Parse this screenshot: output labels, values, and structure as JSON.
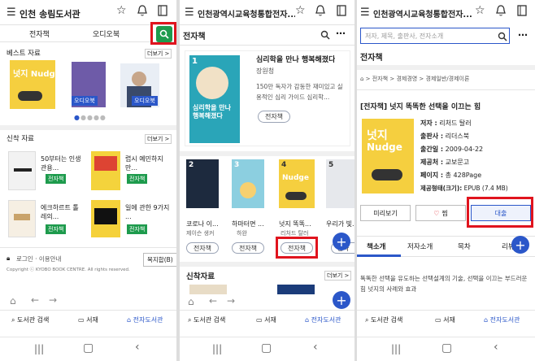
{
  "panel1": {
    "title": "인천 송림도서관",
    "tab_ebook": "전자책",
    "tab_audiobook": "오디오북",
    "best_heading": "베스트 자료",
    "more": "더보기 >",
    "best_books": [
      {
        "title": "넛지 Nudge",
        "badge": ""
      },
      {
        "title": "",
        "badge": "오디오북"
      },
      {
        "title": "",
        "badge": "오디오북"
      }
    ],
    "new_heading": "신착 자료",
    "new_books": [
      {
        "title": "50부터는 인생 관용...",
        "badge": "전자책"
      },
      {
        "title": "렵시 예민하지 만...",
        "badge": "전자책"
      },
      {
        "title": "에크하르트 톨 레의...",
        "badge": "전자책"
      },
      {
        "title": "일에 관한 9가지 ...",
        "badge": "전자책"
      }
    ],
    "footer_links": "로그인 · 이용안내",
    "copyright": "Copyright ⓒ KYOBO BOOK CENTRE. All rights reserved.",
    "complex_button": "복지합(B)",
    "bottom_search": "도서관 검색",
    "bottom_shelf": "서재",
    "bottom_elib": "전자도서관"
  },
  "panel2": {
    "title": "인천광역시교육청통합전자...",
    "section": "전자책",
    "featured_rank": "1",
    "featured_title": "심리학을 만나 행복해졌다",
    "featured_author": "장원청",
    "featured_desc": "150만 독자가 감동한 재미있고 실용적인 심리 가이드 심리학...",
    "featured_badge": "전자책",
    "cover_title": "심리학을 만나 행복해졌다",
    "ranked": [
      {
        "rank": "2",
        "title": "코로나 이...",
        "author": "제이슨 생커",
        "badge": "전자책"
      },
      {
        "rank": "3",
        "title": "하마터면 ...",
        "author": "하완",
        "badge": "전자책"
      },
      {
        "rank": "4",
        "title": "넛지 똑똑...",
        "author": "리처드 탈러",
        "badge": "전자책"
      },
      {
        "rank": "5",
        "title": "우리가 빛...",
        "author": "",
        "badge": "전자"
      }
    ],
    "new_heading": "신착자료",
    "more": "더보기 >",
    "bottom_search": "도서관 검색",
    "bottom_shelf": "서재",
    "bottom_elib": "전자도서관"
  },
  "panel3": {
    "title": "인천광역시교육청통합전자...",
    "search_placeholder": "저자, 제목, 출판사, 전자소개",
    "section": "전자책",
    "breadcrumb": [
      "전자책",
      "경제경영",
      "경제일반/경제이론"
    ],
    "book_title": "[전자책] 넛지 똑똑한 선택을 이끄는 힘",
    "details": [
      {
        "label": "저자 :",
        "value": "리처드 탈러"
      },
      {
        "label": "출판사 :",
        "value": "리더스북"
      },
      {
        "label": "출간일 :",
        "value": "2009-04-22"
      },
      {
        "label": "제공처 :",
        "value": "교보문고"
      },
      {
        "label": "페이지 :",
        "value": "총 428Page"
      },
      {
        "label": "제공형태(크기):",
        "value": "EPUB (7.4 MB)"
      }
    ],
    "preview_button": "미리보기",
    "wish_button": "찜",
    "borrow_button": "대출",
    "tabs": [
      "책소개",
      "저자소개",
      "목차",
      "리뷰"
    ],
    "intro_text": "똑똑한 선택을 유도하는 선택설계의 기술, 선택을 이끄는 부드러운 힘 넛지의 사례와 효과",
    "bottom_search": "도서관 검색",
    "bottom_shelf": "서재",
    "bottom_elib": "전자도서관"
  },
  "colors": {
    "accent": "#2b57c9",
    "highlight": "#e0141e",
    "green": "#1e9b4d"
  }
}
